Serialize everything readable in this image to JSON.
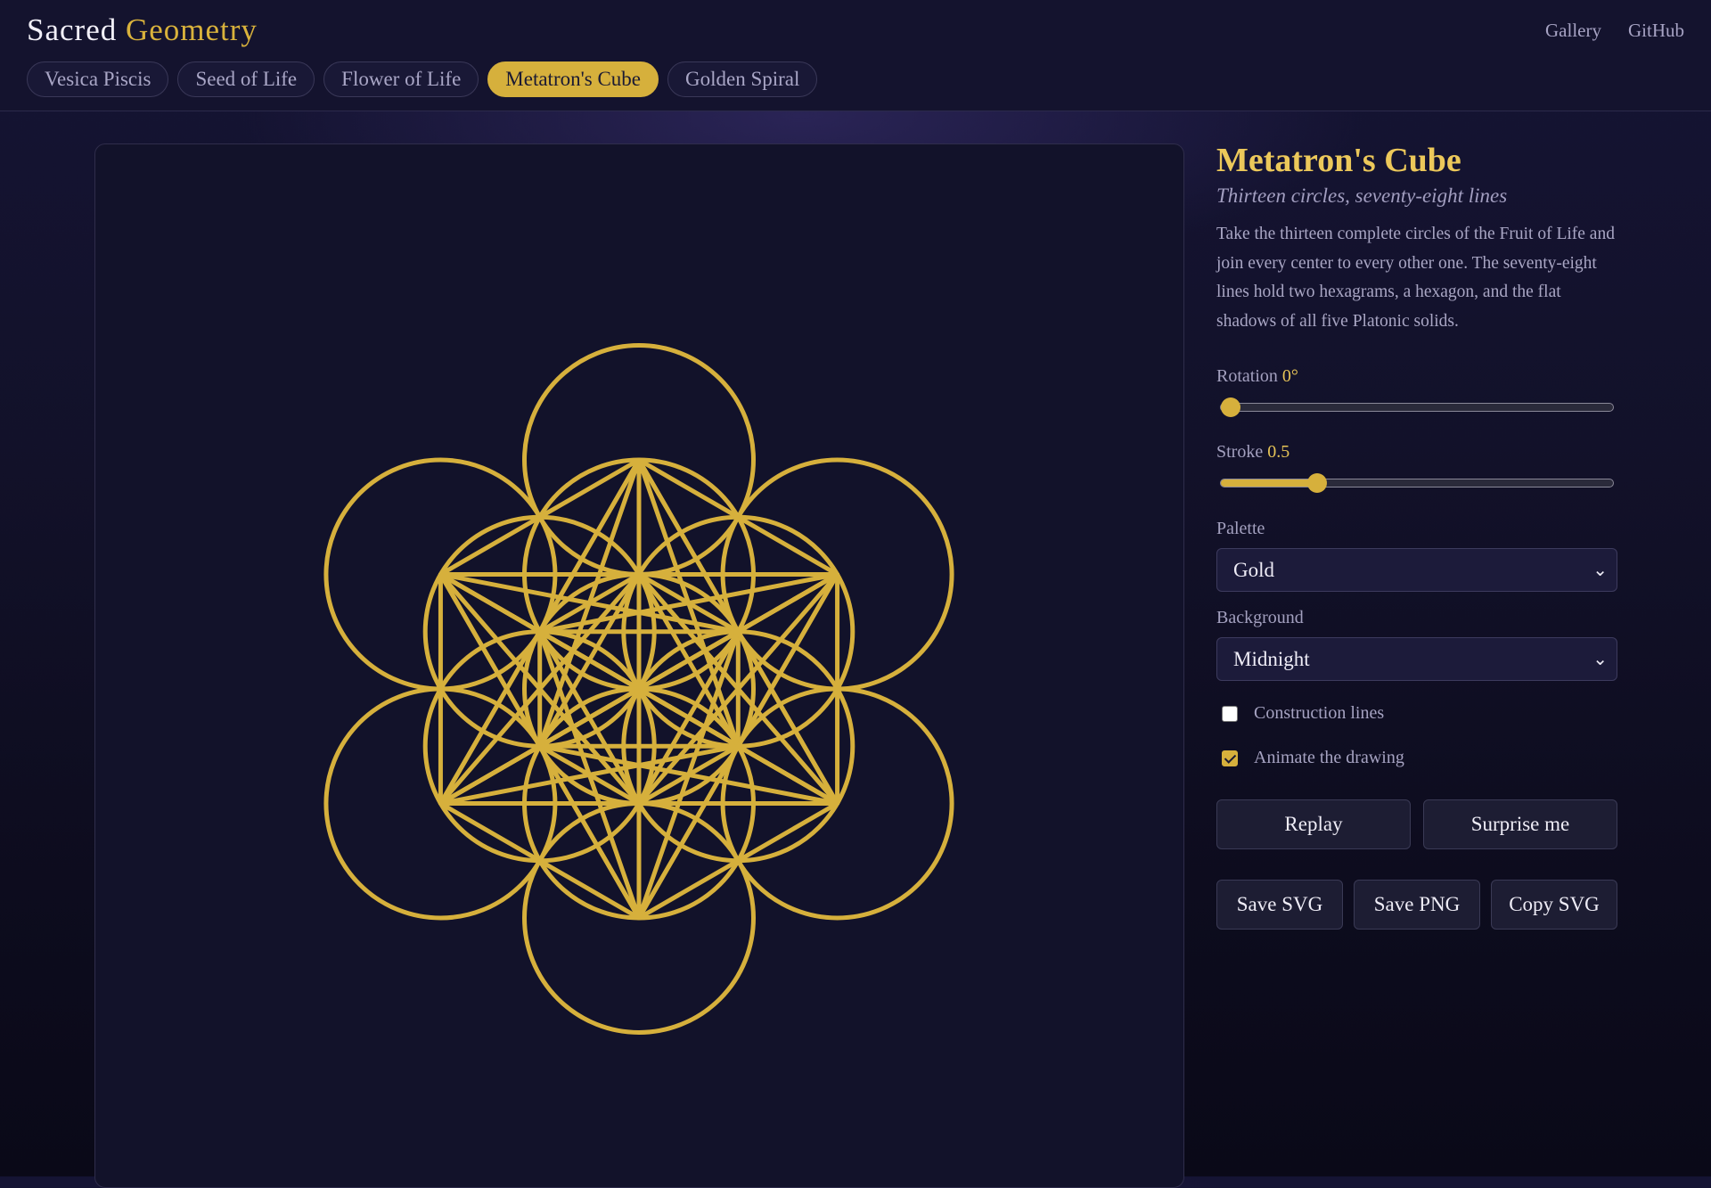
{
  "brand": {
    "word1": "Sacred",
    "word2": "Geometry"
  },
  "topnav": {
    "gallery": "Gallery",
    "github": "GitHub"
  },
  "tabs": [
    {
      "label": "Vesica Piscis",
      "active": false
    },
    {
      "label": "Seed of Life",
      "active": false
    },
    {
      "label": "Flower of Life",
      "active": false
    },
    {
      "label": "Metatron's Cube",
      "active": true
    },
    {
      "label": "Golden Spiral",
      "active": false
    }
  ],
  "panel": {
    "title": "Metatron's Cube",
    "subtitle": "Thirteen circles, seventy-eight lines",
    "description": "Take the thirteen complete circles of the Fruit of Life and join every center to every other one. The seventy-eight lines hold two hexagrams, a hexagon, and the flat shadows of all five Platonic solids.",
    "rotation": {
      "label": "Rotation",
      "value_text": "0°",
      "value": 0,
      "min": 0,
      "max": 360
    },
    "stroke": {
      "label": "Stroke",
      "value_text": "0.5",
      "fraction": 0.23
    },
    "palette": {
      "label": "Palette",
      "selected": "Gold"
    },
    "background": {
      "label": "Background",
      "selected": "Midnight"
    },
    "construction_lines": {
      "label": "Construction lines",
      "checked": false
    },
    "animate": {
      "label": "Animate the drawing",
      "checked": true
    },
    "buttons": {
      "replay": "Replay",
      "surprise": "Surprise me",
      "save_svg": "Save SVG",
      "save_png": "Save PNG",
      "copy_svg": "Copy SVG"
    }
  },
  "colors": {
    "gold": "#d6b03c",
    "accent_text": "#ecc85a",
    "background": "#12122a"
  }
}
